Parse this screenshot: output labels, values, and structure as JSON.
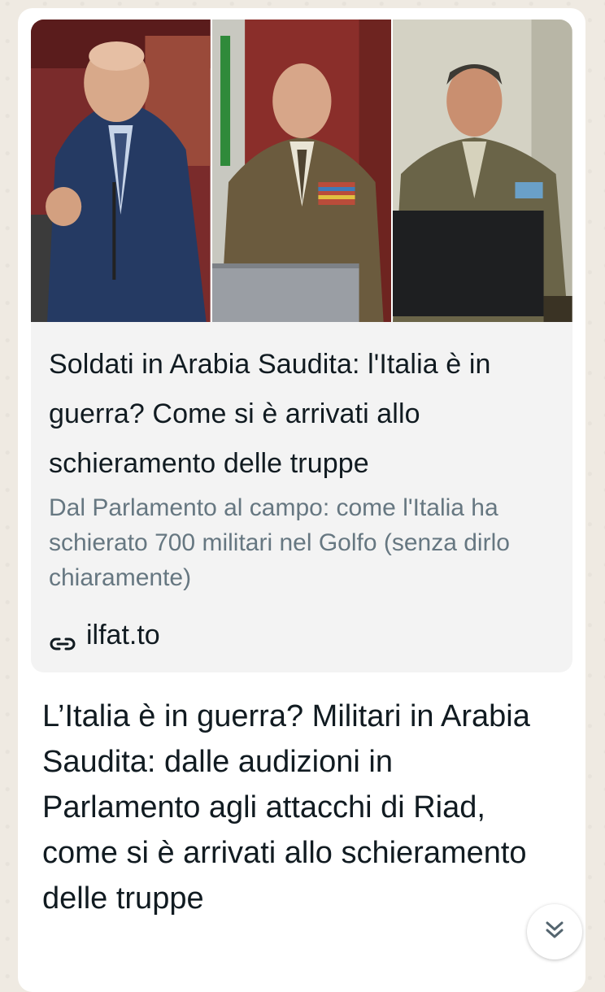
{
  "preview": {
    "images": [
      {
        "icon": "photo-politician-in-parliament"
      },
      {
        "icon": "photo-general-at-hearing"
      },
      {
        "icon": "photo-officer-at-hearing"
      }
    ],
    "title": "Soldati in Arabia Saudita: l'Italia è in guerra? Come si è arrivati allo schieramento delle truppe",
    "description": "Dal Parlamento al campo: come l'Italia ha schierato 700 militari nel Golfo (senza dirlo chiaramente)",
    "link_icon": "link-icon",
    "domain": "ilfat.to"
  },
  "message": {
    "text": "L’Italia è in guerra? Militari in Arabia Saudita: dalle audizioni in Parlamento agli attacchi di Riad, come si è arrivati allo schieramento delle truppe"
  },
  "scroll_button": {
    "icon": "chevrons-down-icon"
  },
  "colors": {
    "chat_background": "#efeae2",
    "bubble": "#ffffff",
    "preview_background": "#f3f3f3",
    "primary_text": "#111b21",
    "secondary_text": "#667781"
  }
}
